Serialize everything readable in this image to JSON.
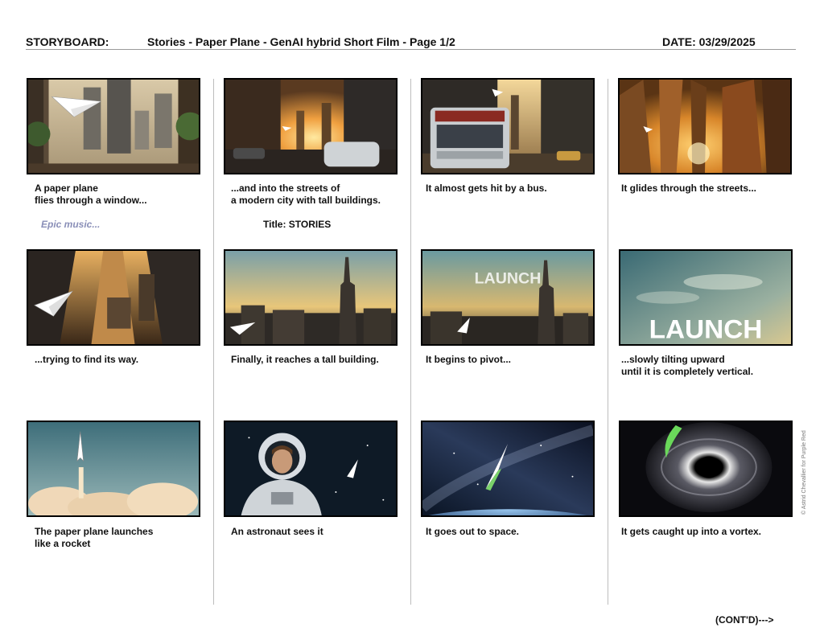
{
  "header": {
    "label": "STORYBOARD:",
    "title": "Stories - Paper Plane - GenAI hybrid Short Film - Page 1/2",
    "date": "DATE: 03/29/2025"
  },
  "panels": [
    {
      "caption": "A paper plane\nflies through a window...",
      "scene": "window-city"
    },
    {
      "caption": "...and into the streets of\na modern city with tall buildings.",
      "scene": "city-street-sunset"
    },
    {
      "caption": "It almost gets hit by a bus.",
      "scene": "bus-street"
    },
    {
      "caption": "It glides through the streets...",
      "scene": "skyscrapers-sunset"
    },
    {
      "caption": "...trying to find its way.",
      "scene": "aerial-city"
    },
    {
      "caption": "Finally, it reaches a tall building.",
      "scene": "empire-state-skyline"
    },
    {
      "caption": "It begins to pivot...",
      "scene": "empire-state-launch"
    },
    {
      "caption": "...slowly tilting upward\nuntil it is completely vertical.",
      "scene": "sky-launch-title"
    },
    {
      "caption": "The paper plane launches\nlike a rocket",
      "scene": "rocket-launch"
    },
    {
      "caption": "An astronaut sees it",
      "scene": "astronaut"
    },
    {
      "caption": "It goes out to space.",
      "scene": "earth-space"
    },
    {
      "caption": "It gets caught up into a vortex.",
      "scene": "black-hole"
    }
  ],
  "notes": {
    "music": "Epic music...",
    "title_card": "Title: STORIES"
  },
  "frame_text": {
    "launch_small": "LAUNCH",
    "launch_big": "LAUNCH"
  },
  "credit": "© Astrid Chevallier for Purple Red",
  "footer": "(CONT'D)--->"
}
